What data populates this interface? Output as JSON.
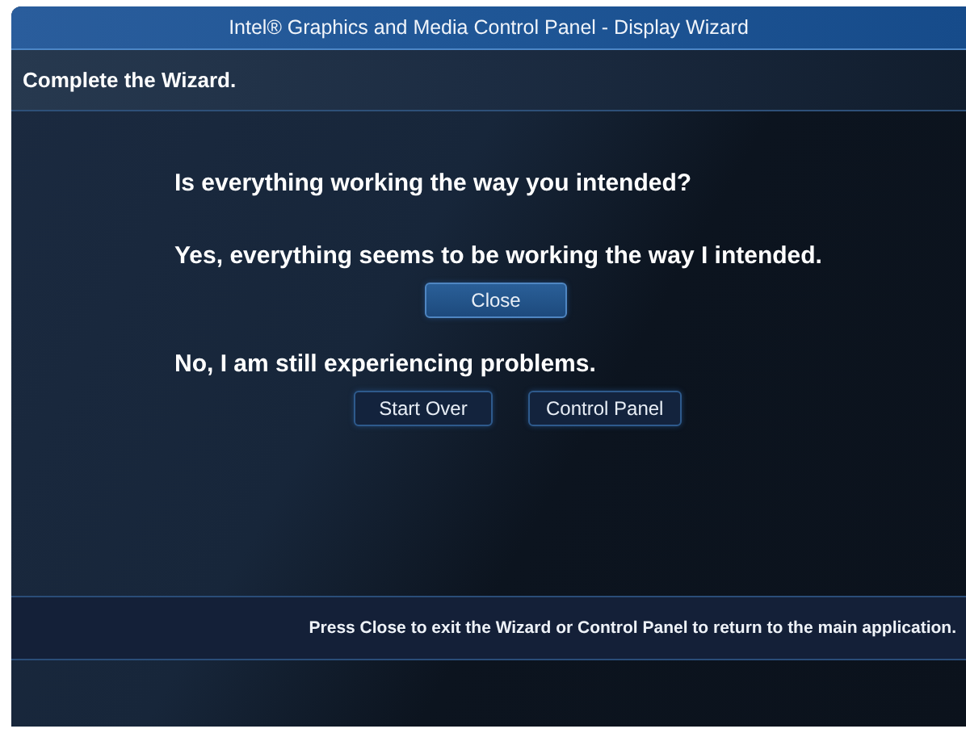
{
  "window": {
    "title": "Intel® Graphics and Media Control Panel - Display Wizard"
  },
  "header": {
    "title": "Complete the Wizard."
  },
  "question": "Is everything working the way you intended?",
  "sections": [
    {
      "text": "Yes, everything seems to be working the way I intended.",
      "buttons": [
        {
          "label": "Close",
          "focused": true
        }
      ]
    },
    {
      "text": "No, I am still experiencing problems.",
      "buttons": [
        {
          "label": "Start Over",
          "focused": false
        },
        {
          "label": "Control Panel",
          "focused": false
        }
      ]
    }
  ],
  "footer": "Press Close to exit the Wizard or Control Panel to return to the main application."
}
